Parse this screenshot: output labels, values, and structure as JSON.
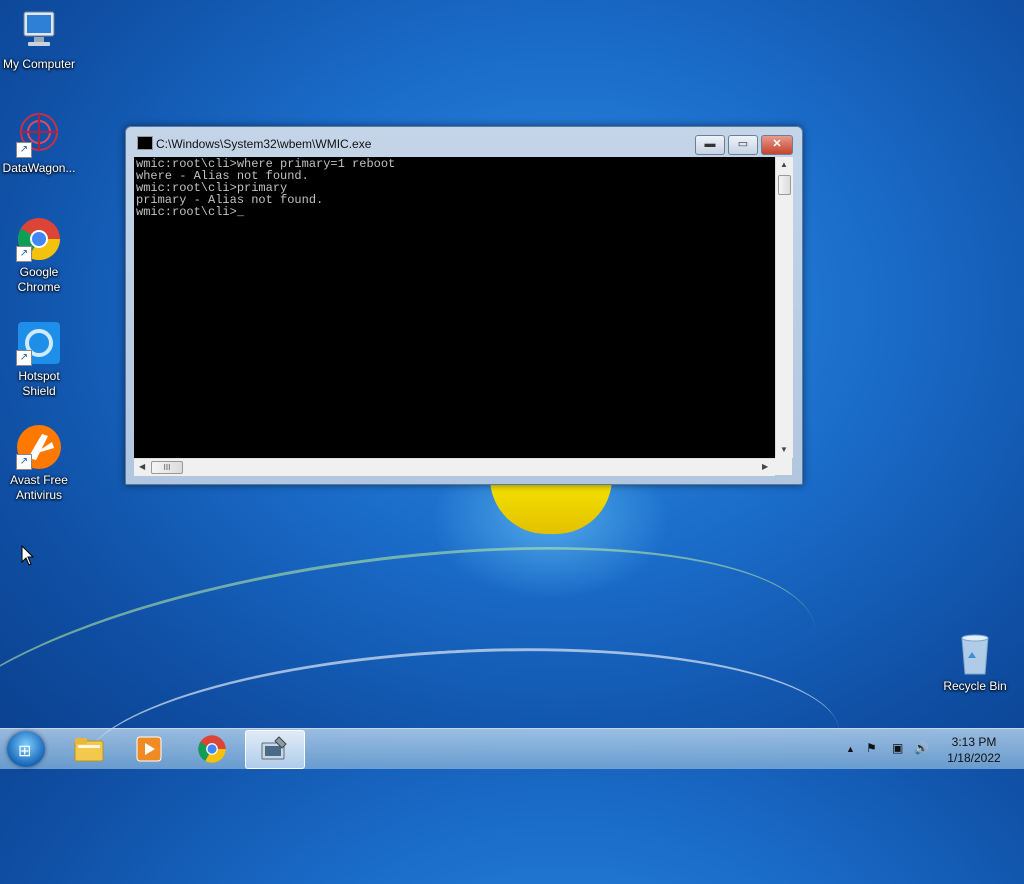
{
  "desktop": {
    "icons": [
      {
        "label": "My Computer",
        "icon": "computer-icon"
      },
      {
        "label": "DataWagon...",
        "icon": "datawagon-icon"
      },
      {
        "label": "Google Chrome",
        "icon": "chrome-icon"
      },
      {
        "label": "Hotspot Shield",
        "icon": "hotspot-shield-icon"
      },
      {
        "label": "Avast Free Antivirus",
        "icon": "avast-icon"
      },
      {
        "label": "Recycle Bin",
        "icon": "recycle-bin-icon"
      }
    ]
  },
  "console": {
    "title": "C:\\Windows\\System32\\wbem\\WMIC.exe",
    "lines": [
      "wmic:root\\cli>where primary=1 reboot",
      "where - Alias not found.",
      "wmic:root\\cli>primary",
      "primary - Alias not found.",
      "wmic:root\\cli>"
    ],
    "minimize_glyph": "▬",
    "maximize_glyph": "▭",
    "close_glyph": "✕",
    "thumb_glyph": "III"
  },
  "taskbar": {
    "start_glyph": "⊞",
    "apps": [
      "file-explorer-icon",
      "media-player-icon",
      "chrome-icon",
      "wmic-icon"
    ],
    "tray_icons": [
      "show-hidden-icon",
      "action-center-icon",
      "network-icon",
      "volume-icon"
    ],
    "tray_glyphs": [
      "▲",
      "⚑",
      "▣",
      "🔊"
    ],
    "clock_time": "3:13 PM",
    "clock_date": "1/18/2022"
  },
  "colors": {
    "console_bg": "#000000",
    "console_fg": "#c0c0c0",
    "wallpaper": "#1a6cc9"
  }
}
